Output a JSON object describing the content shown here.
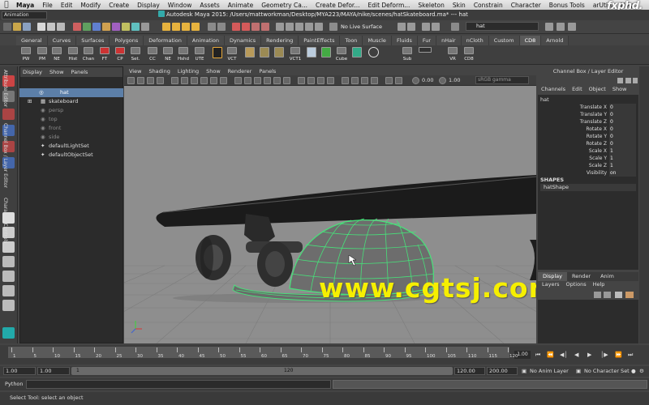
{
  "menubar": {
    "apple": "",
    "items": [
      "Maya",
      "File",
      "Edit",
      "Modify",
      "Create",
      "Display",
      "Window",
      "Assets",
      "Animate",
      "Geometry Ca...",
      "Create Defor...",
      "Edit Deform...",
      "Skeleton",
      "Skin",
      "Constrain",
      "Character",
      "Bonus Tools",
      "arUtils",
      "Help"
    ],
    "watermark": "fxphd."
  },
  "titlebar": {
    "module": "Animation",
    "title": "Autodesk Maya 2015: /Users/mattworkman/Desktop/MYA223/MAYA/nike/scenes/hatSkateboard.ma*   ---   hat"
  },
  "status": {
    "live_surface": "No Live Surface",
    "selection_field": "hat"
  },
  "shelf": {
    "tabs": [
      "General",
      "Curves",
      "Surfaces",
      "Polygons",
      "Deformation",
      "Animation",
      "Dynamics",
      "Rendering",
      "PaintEffects",
      "Toon",
      "Muscle",
      "Fluids",
      "Fur",
      "nHair",
      "nCloth",
      "Custom",
      "CD8",
      "Arnold"
    ],
    "active_tab": "CD8",
    "buttons": [
      "PW",
      "PM",
      "NE",
      "Hist",
      "Chan",
      "FT",
      "CP",
      "Set.",
      "CC",
      "NE",
      "Hshd",
      "UTE",
      "VCT",
      "",
      "",
      "",
      "",
      "VCT1",
      "",
      "",
      "Cube",
      "",
      "",
      "Sub",
      "",
      "VR",
      "CD8"
    ]
  },
  "outliner": {
    "menus": [
      "Display",
      "Show",
      "Panels"
    ],
    "rows": [
      {
        "label": "hat",
        "state": "selected",
        "icon": "mesh-icon"
      },
      {
        "label": "skateboard",
        "state": "normal",
        "icon": "group-icon"
      },
      {
        "label": "persp",
        "state": "dim",
        "icon": "camera-icon"
      },
      {
        "label": "top",
        "state": "dim",
        "icon": "camera-icon"
      },
      {
        "label": "front",
        "state": "dim",
        "icon": "camera-icon"
      },
      {
        "label": "side",
        "state": "dim",
        "icon": "camera-icon"
      },
      {
        "label": "defaultLightSet",
        "state": "normal",
        "icon": "set-icon"
      },
      {
        "label": "defaultObjectSet",
        "state": "normal",
        "icon": "set-icon"
      }
    ]
  },
  "viewport": {
    "menus": [
      "View",
      "Shading",
      "Lighting",
      "Show",
      "Renderer",
      "Panels"
    ],
    "exposure": "0.00",
    "gamma": "1.00",
    "color_space": "sRGB gamma",
    "overlay_text": "www.cgtsj.com"
  },
  "channelbox": {
    "header": "Channel Box / Layer Editor",
    "menus": [
      "Channels",
      "Edit",
      "Object",
      "Show"
    ],
    "object": "hat",
    "attributes": [
      {
        "name": "Translate X",
        "value": "0"
      },
      {
        "name": "Translate Y",
        "value": "0"
      },
      {
        "name": "Translate Z",
        "value": "0"
      },
      {
        "name": "Rotate X",
        "value": "0"
      },
      {
        "name": "Rotate Y",
        "value": "0"
      },
      {
        "name": "Rotate Z",
        "value": "0"
      },
      {
        "name": "Scale X",
        "value": "1"
      },
      {
        "name": "Scale Y",
        "value": "1"
      },
      {
        "name": "Scale Z",
        "value": "1"
      },
      {
        "name": "Visibility",
        "value": "on"
      }
    ],
    "shapes_title": "SHAPES",
    "shape": "hatShape"
  },
  "layereditor": {
    "tabs": [
      "Display",
      "Render",
      "Anim"
    ],
    "active_tab": "Display",
    "menus": [
      "Layers",
      "Options",
      "Help"
    ]
  },
  "sidetabs": [
    "Attribute Editor",
    "Channel Box / Layer Editor",
    "Character Controls"
  ],
  "timeline": {
    "ticks": [
      "1",
      "5",
      "10",
      "15",
      "20",
      "25",
      "30",
      "35",
      "40",
      "45",
      "50",
      "55",
      "60",
      "65",
      "70",
      "75",
      "80",
      "85",
      "90",
      "95",
      "100",
      "105",
      "110",
      "115",
      "120"
    ],
    "current": "1.00"
  },
  "range": {
    "start": "1.00",
    "inner_start": "1.00",
    "slider_low": "1",
    "slider_high": "120",
    "end": "120.00",
    "anim_end": "200.00",
    "anim_layer": "No Anim Layer",
    "character_set": "No Character Set"
  },
  "python": {
    "label": "Python"
  },
  "help": {
    "text": "Select Tool: select an object"
  },
  "colors": {
    "wire_green": "#48e07a",
    "selected_row": "#5c7fa8",
    "overlay_yellow": "#f6ef00"
  }
}
